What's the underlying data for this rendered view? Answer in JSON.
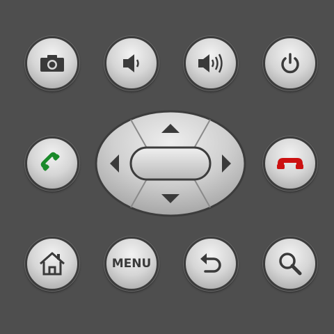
{
  "buttons": {
    "camera": {
      "icon": "camera-icon"
    },
    "volume_down": {
      "icon": "volume-down-icon"
    },
    "volume_up": {
      "icon": "volume-up-icon"
    },
    "power": {
      "icon": "power-icon"
    },
    "call": {
      "icon": "phone-call-icon",
      "color": "#1a8a2a"
    },
    "end_call": {
      "icon": "phone-end-icon",
      "color": "#cc1111"
    },
    "home": {
      "icon": "home-icon"
    },
    "menu": {
      "label": "MENU"
    },
    "back": {
      "icon": "back-arrow-icon"
    },
    "search": {
      "icon": "search-icon"
    }
  },
  "dpad": {
    "up": {
      "icon": "arrow-up-icon"
    },
    "down": {
      "icon": "arrow-down-icon"
    },
    "left": {
      "icon": "arrow-left-icon"
    },
    "right": {
      "icon": "arrow-right-icon"
    },
    "center": {
      "icon": "center-select"
    }
  },
  "colors": {
    "background": "#4e4e4e",
    "button_face": "#d6d6d6",
    "glyph": "#3a3a3a"
  }
}
